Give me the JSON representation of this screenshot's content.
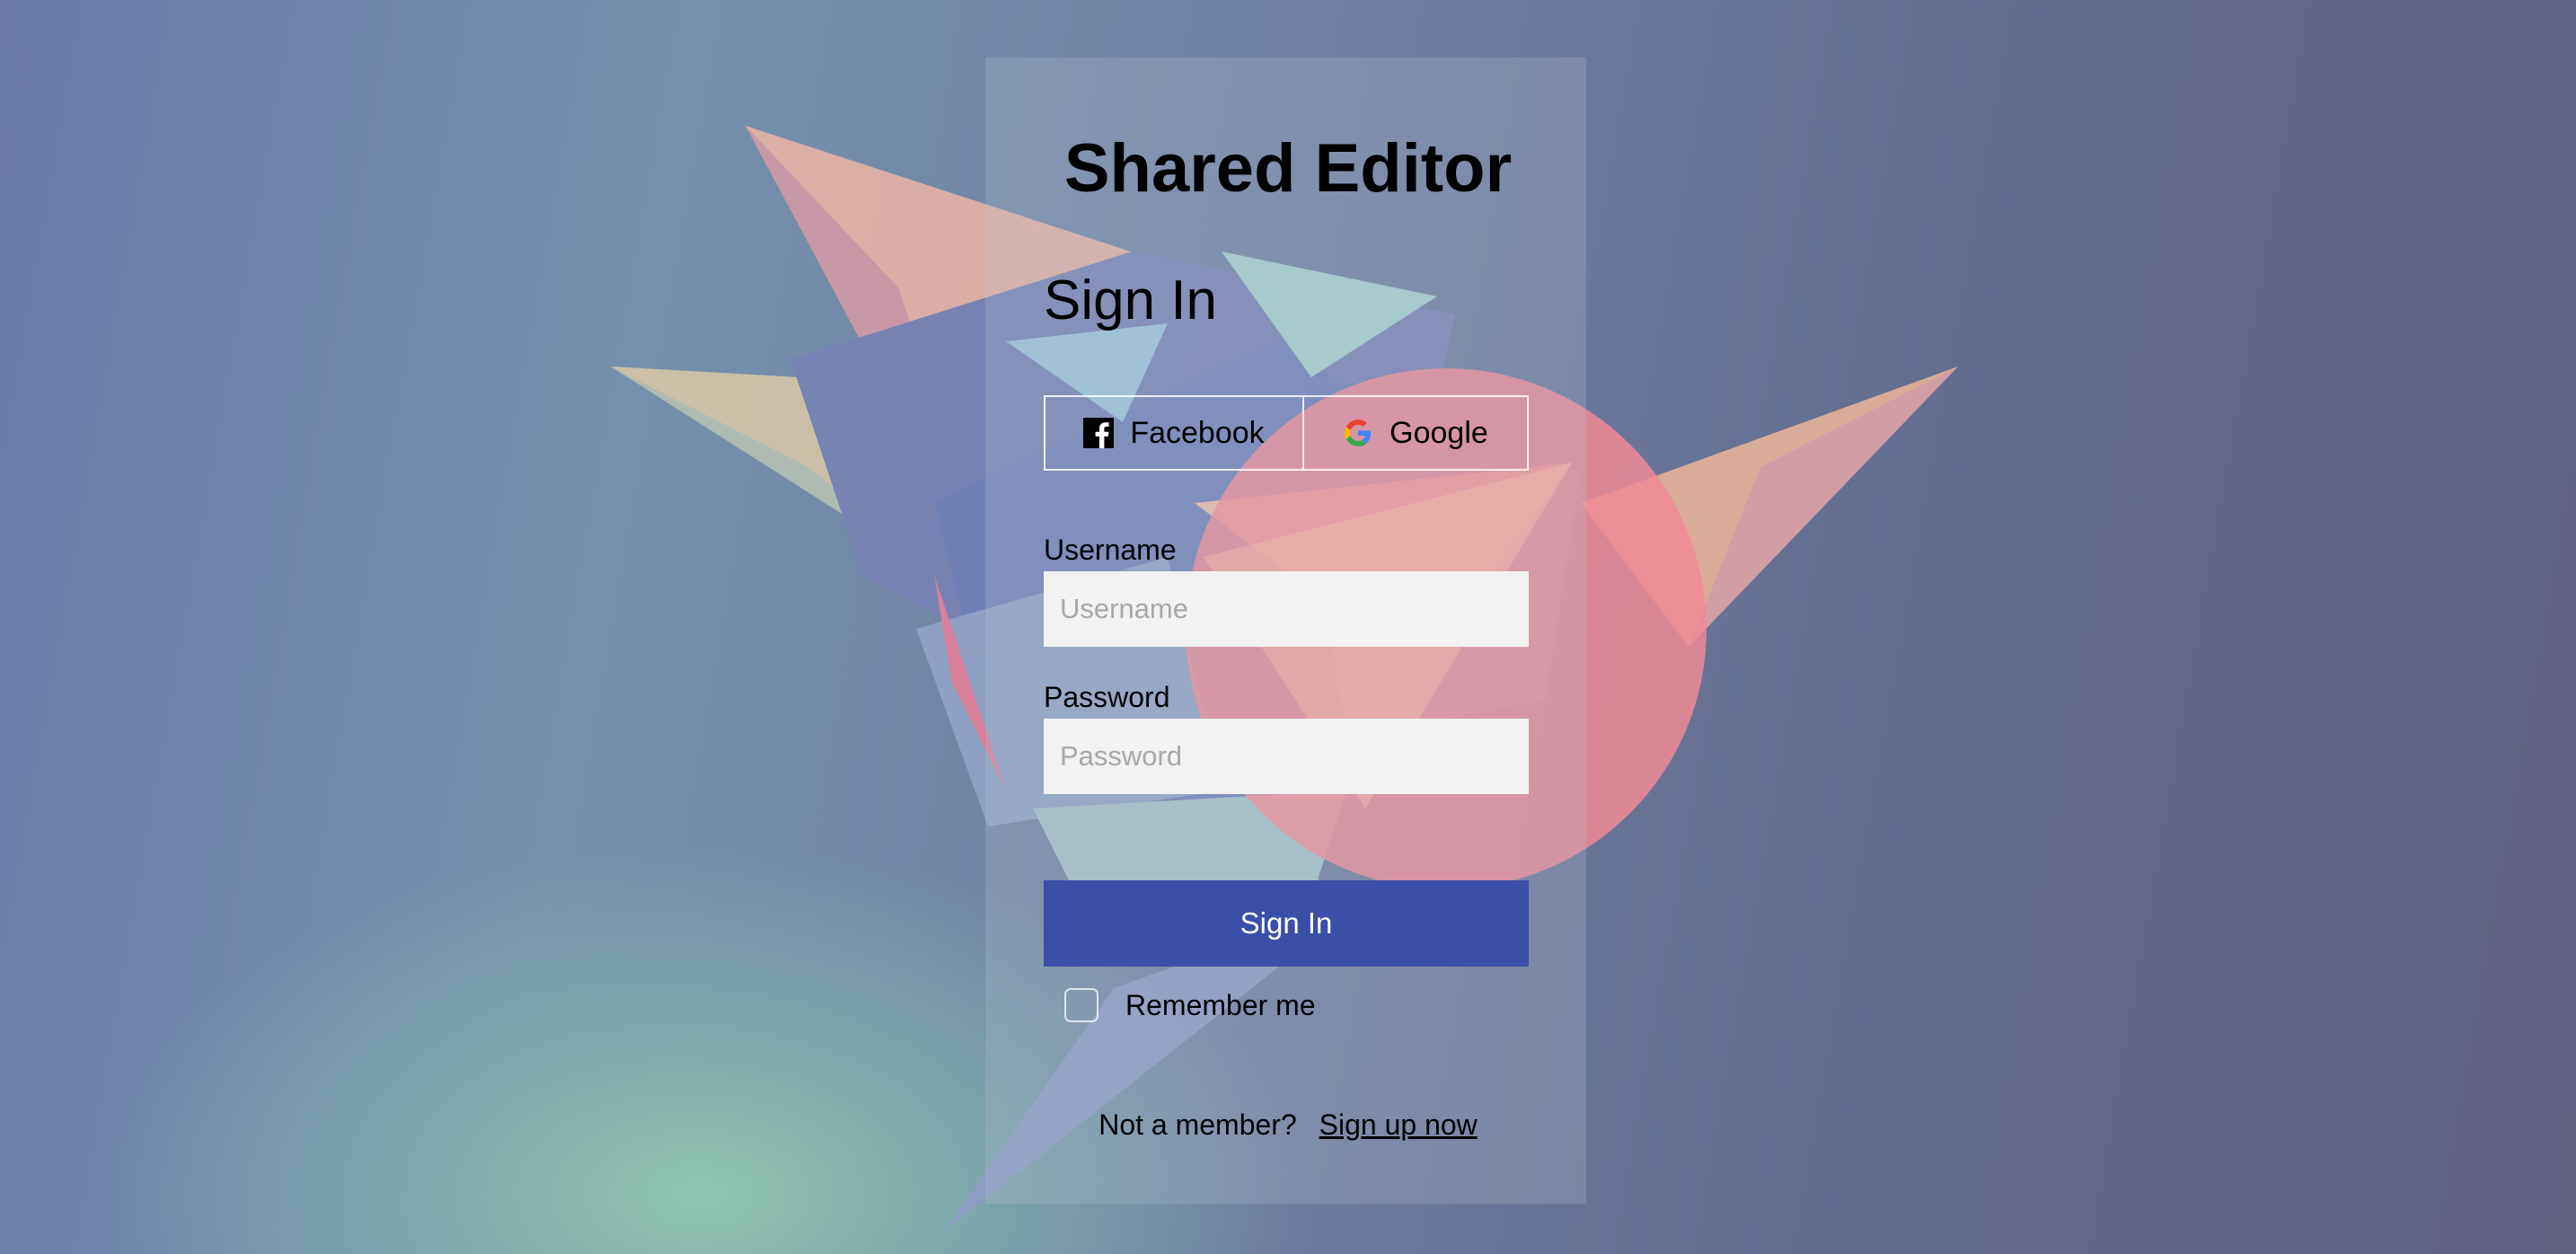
{
  "app_title": "Shared Editor",
  "form": {
    "heading": "Sign In",
    "social": {
      "facebook_label": "Facebook",
      "google_label": "Google"
    },
    "username": {
      "label": "Username",
      "placeholder": "Username",
      "value": ""
    },
    "password": {
      "label": "Password",
      "placeholder": "Password",
      "value": ""
    },
    "submit_label": "Sign In",
    "remember_label": "Remember me",
    "remember_checked": false,
    "signup_prompt": "Not a member?",
    "signup_link": "Sign up now"
  },
  "icons": {
    "facebook": "facebook-icon",
    "google": "google-icon"
  },
  "colors": {
    "primary_button": "#3b4ea8",
    "input_background": "#f2f2f2",
    "accent_circle": "#f08a95"
  }
}
